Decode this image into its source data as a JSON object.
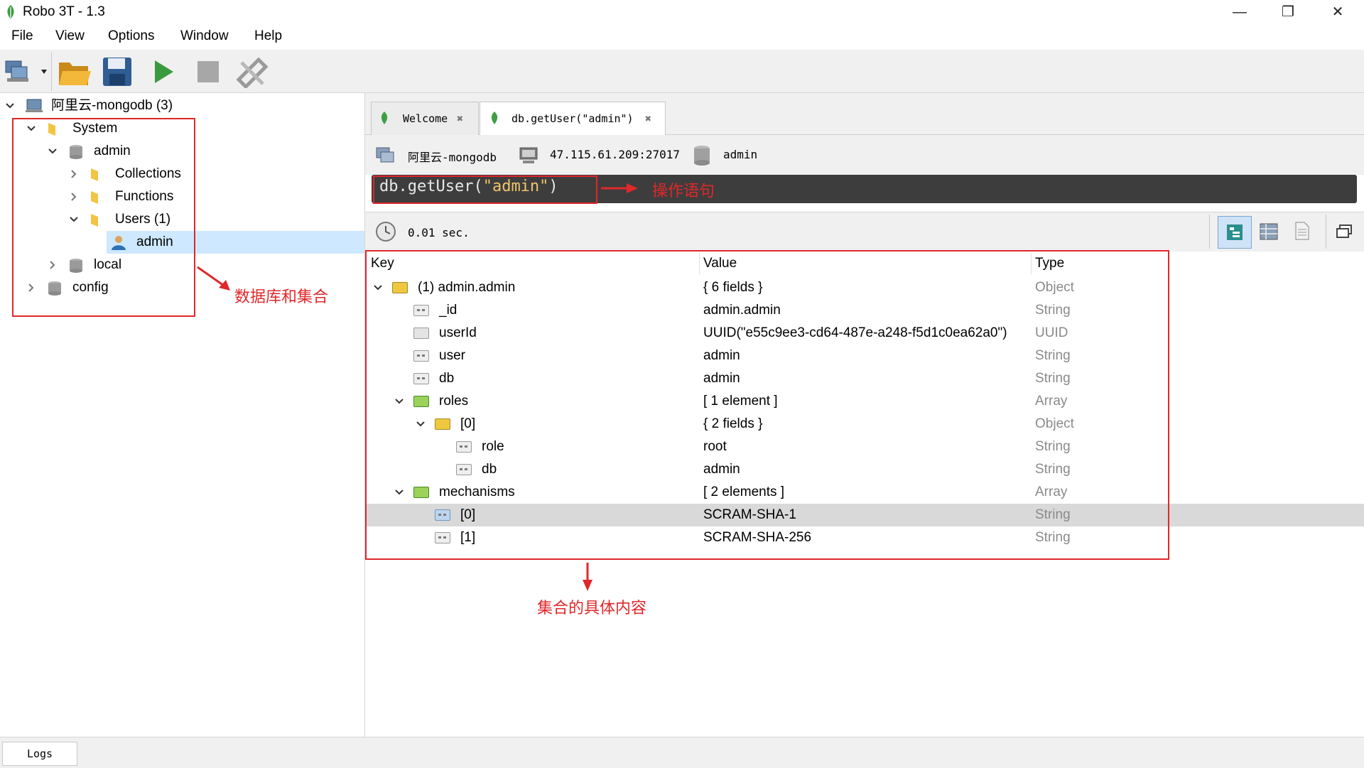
{
  "window": {
    "title": "Robo 3T - 1.3",
    "minimize": "—",
    "restore": "❐",
    "close": "✕"
  },
  "menu": [
    "File",
    "View",
    "Options",
    "Window",
    "Help"
  ],
  "toolbar": {
    "icons": [
      "connect-icon",
      "open-folder-icon",
      "save-icon",
      "run-icon",
      "stop-icon",
      "refresh-icon"
    ]
  },
  "tree": {
    "root": "阿里云-mongodb (3)",
    "system": "System",
    "admin_db": "admin",
    "collections": "Collections",
    "functions": "Functions",
    "users": "Users (1)",
    "admin_user": "admin",
    "local": "local",
    "config": "config"
  },
  "tabs": [
    {
      "label": "Welcome",
      "close": "✖"
    },
    {
      "label": "db.getUser(\"admin\")",
      "close": "✖"
    }
  ],
  "info": {
    "connection": "阿里云-mongodb",
    "address": "47.115.61.209:27017",
    "database": "admin"
  },
  "query": {
    "prefix": "db.getUser(",
    "arg": "\"admin\"",
    "suffix": ")"
  },
  "timing": "0.01 sec.",
  "columns": {
    "key": "Key",
    "value": "Value",
    "type": "Type"
  },
  "rows": [
    {
      "key": "(1) admin.admin",
      "value": "{ 6 fields }",
      "type": "Object"
    },
    {
      "key": "_id",
      "value": "admin.admin",
      "type": "String"
    },
    {
      "key": "userId",
      "value": "UUID(\"e55c9ee3-cd64-487e-a248-f5d1c0ea62a0\")",
      "type": "UUID"
    },
    {
      "key": "user",
      "value": "admin",
      "type": "String"
    },
    {
      "key": "db",
      "value": "admin",
      "type": "String"
    },
    {
      "key": "roles",
      "value": "[ 1 element ]",
      "type": "Array"
    },
    {
      "key": "[0]",
      "value": "{ 2 fields }",
      "type": "Object"
    },
    {
      "key": "role",
      "value": "root",
      "type": "String"
    },
    {
      "key": "db",
      "value": "admin",
      "type": "String"
    },
    {
      "key": "mechanisms",
      "value": "[ 2 elements ]",
      "type": "Array"
    },
    {
      "key": "[0]",
      "value": "SCRAM-SHA-1",
      "type": "String"
    },
    {
      "key": "[1]",
      "value": "SCRAM-SHA-256",
      "type": "String"
    }
  ],
  "annotations": {
    "query_note": "操作语句",
    "tree_note": "数据库和集合",
    "result_note": "集合的具体内容"
  },
  "bottom": {
    "logs": "Logs"
  },
  "colors": {
    "annotation": "#e0272a",
    "selection": "#cde8ff",
    "query_bg": "#3d3d3d"
  }
}
